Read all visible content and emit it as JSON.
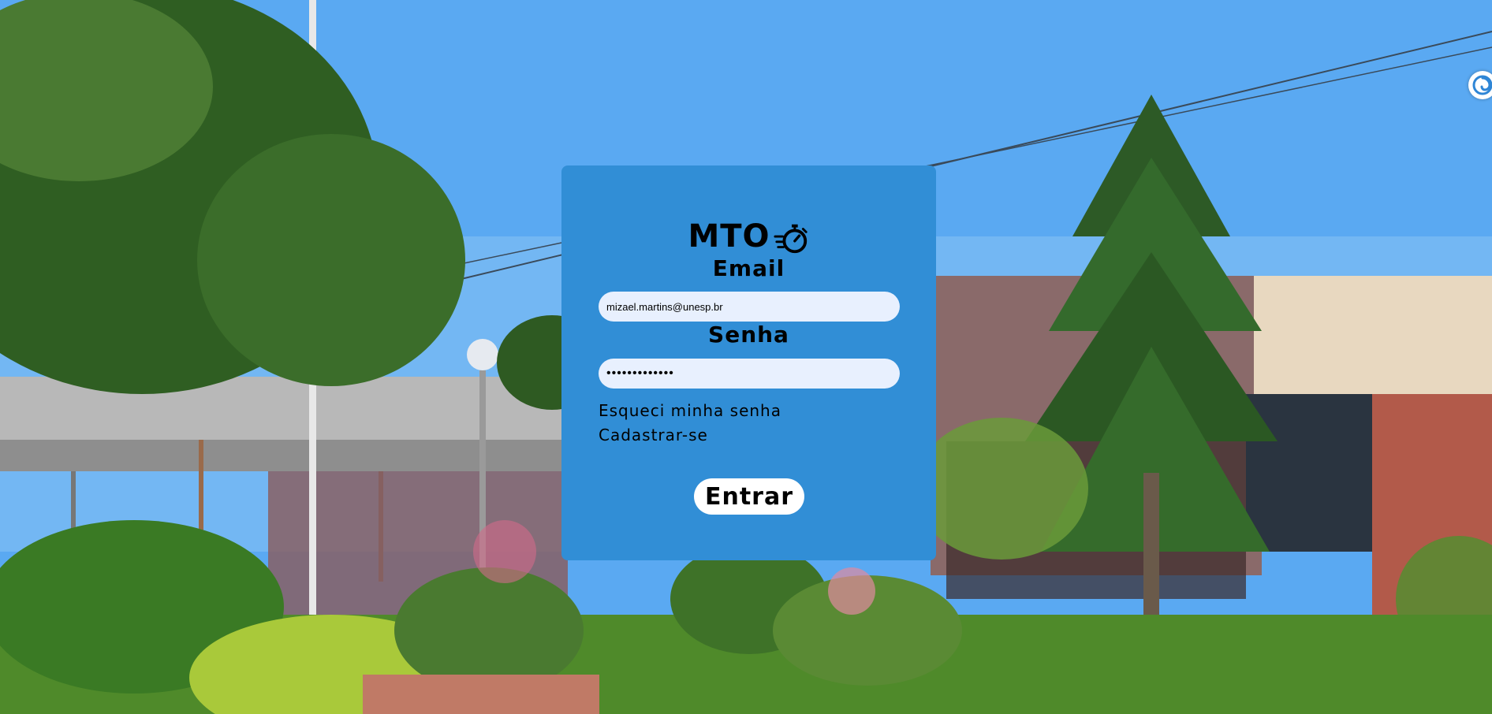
{
  "app": {
    "logo_text": "MTO",
    "logo_icon": "stopwatch-icon"
  },
  "form": {
    "email_label": "Email",
    "email_value": "mizael.martins@unesp.br",
    "password_label": "Senha",
    "password_value": "•••••••••••••",
    "forgot_link": "Esqueci minha senha",
    "signup_link": "Cadastrar-se",
    "submit_label": "Entrar"
  },
  "colors": {
    "card": "#318ed6",
    "input_bg": "#e8f0fe",
    "button_bg": "#ffffff",
    "text": "#000000"
  },
  "extension": {
    "icon": "swirl-icon"
  }
}
